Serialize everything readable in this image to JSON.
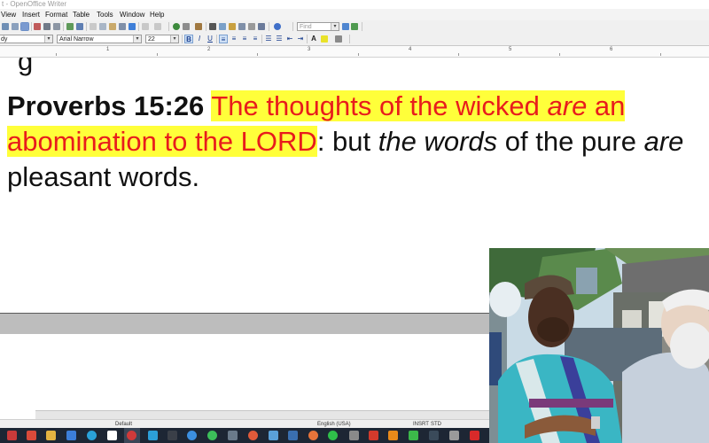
{
  "window": {
    "title": "t - OpenOffice Writer"
  },
  "menu": [
    "View",
    "Insert",
    "Format",
    "Table",
    "Tools",
    "Window",
    "Help"
  ],
  "toolbar": {
    "find_placeholder": "Find"
  },
  "format_bar": {
    "style": "dy",
    "font": "Arial Narrow",
    "size": "22"
  },
  "ruler": {
    "marks": [
      "1",
      "2",
      "3",
      "4",
      "5",
      "6"
    ]
  },
  "document": {
    "reference": "Proverbs 15:26",
    "highlight_part1": "The thoughts of the wicked ",
    "highlight_italic": "are",
    "highlight_part2": " an abomination to the LORD",
    "rest_part1": ": but ",
    "rest_italic1": "the words",
    "rest_part2": " of the pure ",
    "rest_italic2": "are",
    "rest_part3": " pleasant words.",
    "previous_line_fragment": "g"
  },
  "status": {
    "page_style": "Default",
    "language": "English (USA)",
    "insert_mode": "INSRT",
    "selection_mode": "STD"
  },
  "colors": {
    "highlight_bg": "#ffff3a",
    "highlight_text": "#e81c1c",
    "taskbar": "#1d2634"
  },
  "webcam": {
    "description_icon": "video-person-icon"
  }
}
